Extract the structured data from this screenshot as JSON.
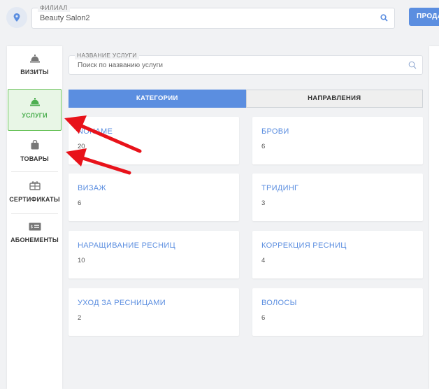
{
  "header": {
    "branch_legend": "ФИЛИАЛ",
    "branch_value": "Beauty Salon2",
    "sell_label": "ПРОДА"
  },
  "sidebar": {
    "items": [
      {
        "label": "ВИЗИТЫ",
        "icon": "bell-icon",
        "active": false
      },
      {
        "label": "УСЛУГИ",
        "icon": "bell-icon",
        "active": true
      },
      {
        "label": "ТОВАРЫ",
        "icon": "bag-icon",
        "active": false
      },
      {
        "label": "СЕРТИФИКАТЫ",
        "icon": "gift-icon",
        "active": false
      },
      {
        "label": "АБОНЕМЕНТЫ",
        "icon": "ticket-icon",
        "active": false
      }
    ]
  },
  "search": {
    "legend": "НАЗВАНИЕ УСЛУГИ",
    "placeholder": "Поиск по названию услуги"
  },
  "tabs": [
    {
      "label": "КАТЕГОРИИ",
      "active": true
    },
    {
      "label": "НАПРАВЛЕНИЯ",
      "active": false
    }
  ],
  "categories": [
    {
      "name": "NONAME",
      "count": "20"
    },
    {
      "name": "БРОВИ",
      "count": "6"
    },
    {
      "name": "ВИЗАЖ",
      "count": "6"
    },
    {
      "name": "ТРИДИНГ",
      "count": "3"
    },
    {
      "name": "НАРАЩИВАНИЕ РЕСНИЦ",
      "count": "10"
    },
    {
      "name": "КОРРЕКЦИЯ РЕСНИЦ",
      "count": "4"
    },
    {
      "name": "УХОД ЗА РЕСНИЦАМИ",
      "count": "2"
    },
    {
      "name": "ВОЛОСЫ",
      "count": "6"
    }
  ],
  "colors": {
    "accent": "#5b8ee0",
    "active_green": "#4caf50",
    "annotation_arrow": "#e8121a"
  }
}
